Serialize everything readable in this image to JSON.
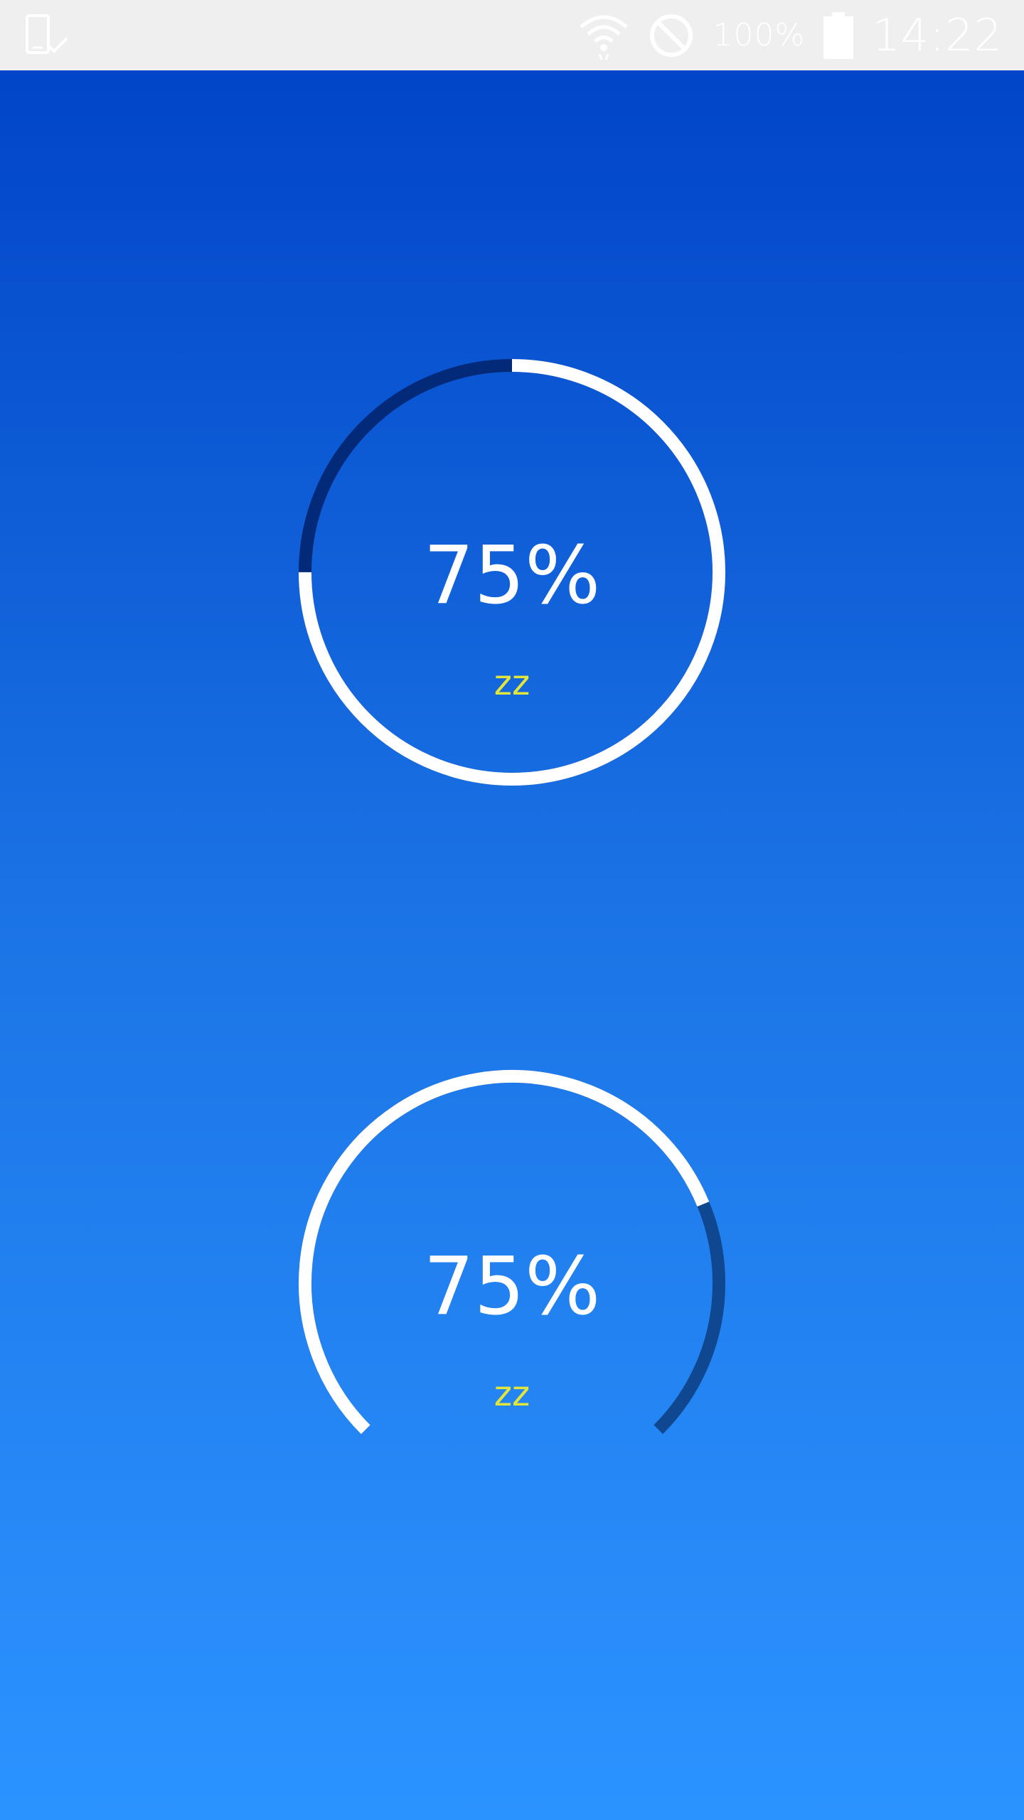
{
  "status_bar": {
    "battery_percent": "100%",
    "time": "14:22",
    "icons": [
      "device-check-icon",
      "wifi-icon",
      "do-not-disturb-icon",
      "battery-icon"
    ]
  },
  "gauges": [
    {
      "style": "full-ring",
      "value_text": "75%",
      "label": "zz",
      "progress": 0.75
    },
    {
      "style": "arc",
      "value_text": "75%",
      "label": "zz",
      "progress": 0.75
    }
  ],
  "colors": {
    "gradient_top": "#0145c8",
    "gradient_bottom": "#2b93ff",
    "progress": "#ffffff",
    "track_ring": "#032a79",
    "track_arc": "#0f4791",
    "label": "#e2e53a"
  }
}
